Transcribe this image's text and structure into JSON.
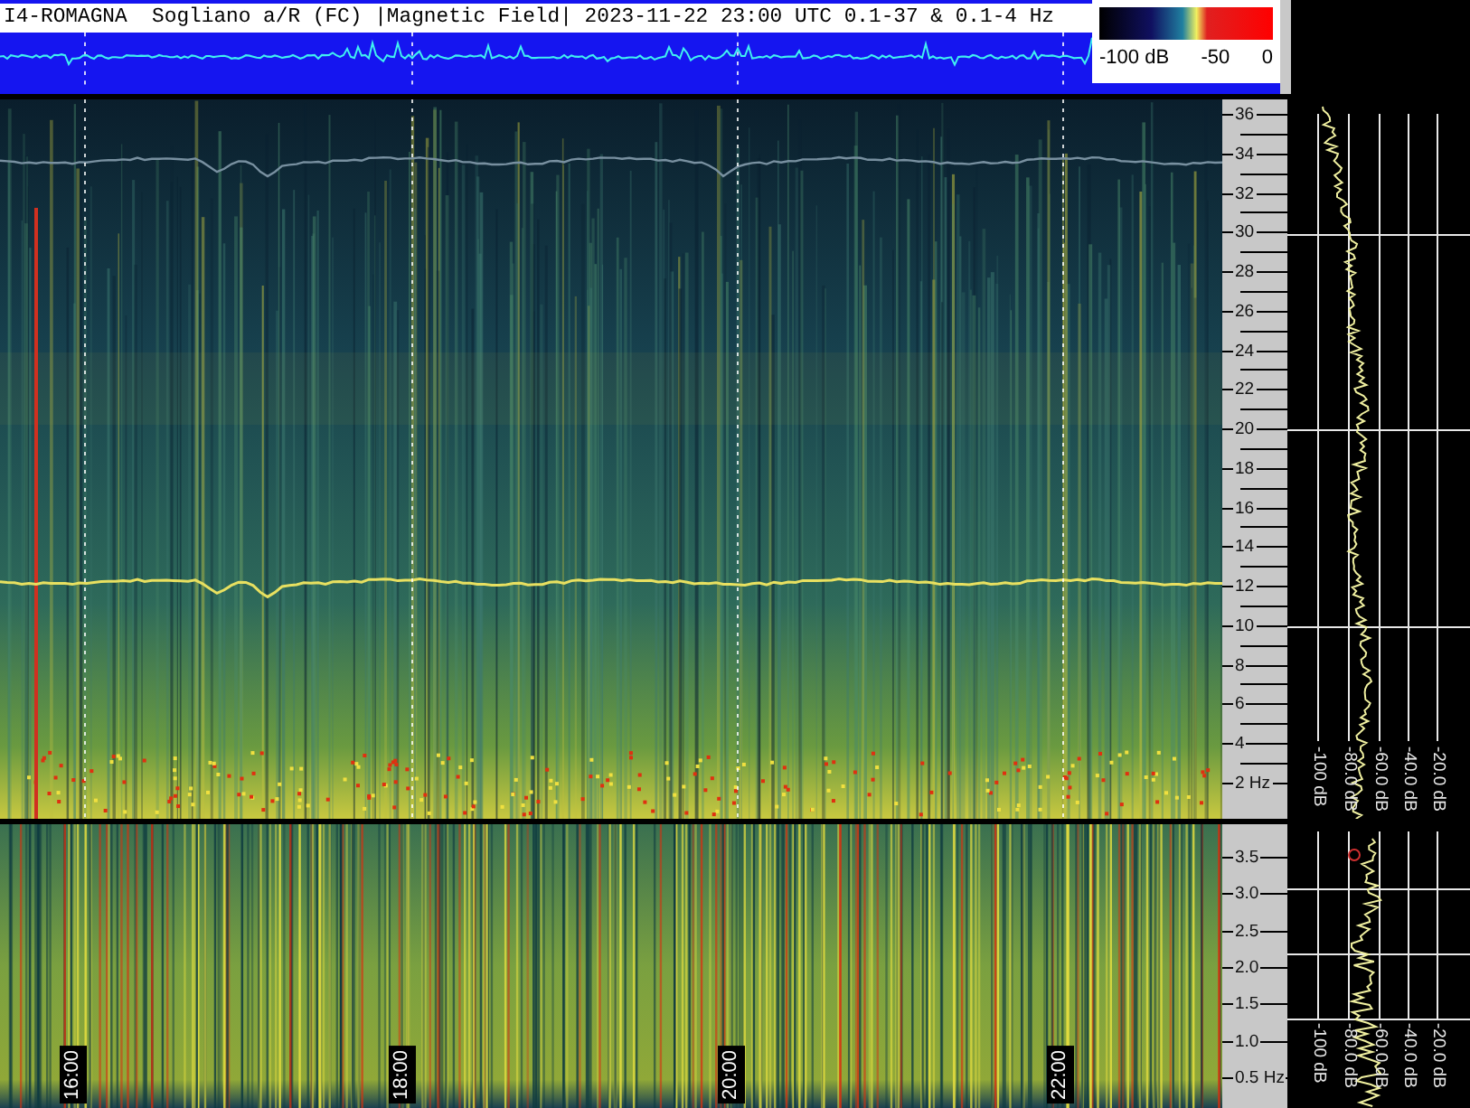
{
  "header": {
    "title": "I4-ROMAGNA  Sogliano a/R (FC) |Magnetic Field| 2023-11-22 23:00 UTC 0.1-37 & 0.1-4 Hz",
    "colorbar_labels": [
      "-100 dB",
      "-50",
      "0"
    ]
  },
  "upper_panel": {
    "freq_ticks": [
      "36",
      "34",
      "32",
      "30",
      "28",
      "26",
      "24",
      "22",
      "20",
      "18",
      "16",
      "14",
      "12",
      "10",
      "8",
      "6",
      "4",
      "2 Hz"
    ],
    "db_labels": [
      "-100 dB",
      "-80.0 dB",
      "-60.0 dB",
      "-40.0 dB",
      "-20.0 dB"
    ]
  },
  "lower_panel": {
    "freq_ticks": [
      "3.5",
      "3.0",
      "2.5",
      "2.0",
      "1.5",
      "1.0",
      "0.5 Hz"
    ],
    "db_labels": [
      "-100 dB",
      "-80.0 dB",
      "-60.0 dB",
      "-40.0 dB",
      "-20.0 dB"
    ],
    "time_labels": [
      "16:00",
      "18:00",
      "20:00",
      "22:00"
    ]
  }
}
